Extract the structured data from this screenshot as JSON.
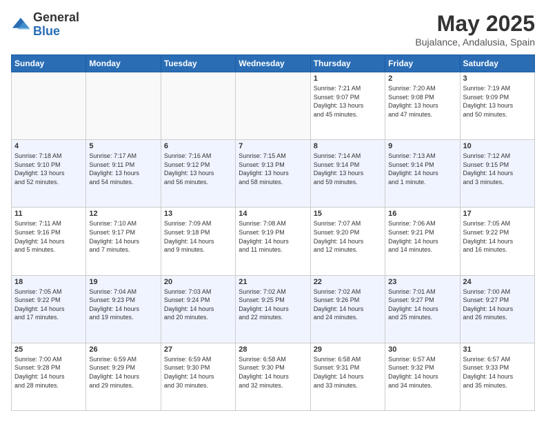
{
  "logo": {
    "general": "General",
    "blue": "Blue"
  },
  "header": {
    "month_title": "May 2025",
    "location": "Bujalance, Andalusia, Spain"
  },
  "weekdays": [
    "Sunday",
    "Monday",
    "Tuesday",
    "Wednesday",
    "Thursday",
    "Friday",
    "Saturday"
  ],
  "weeks": [
    [
      {
        "day": "",
        "info": ""
      },
      {
        "day": "",
        "info": ""
      },
      {
        "day": "",
        "info": ""
      },
      {
        "day": "",
        "info": ""
      },
      {
        "day": "1",
        "info": "Sunrise: 7:21 AM\nSunset: 9:07 PM\nDaylight: 13 hours\nand 45 minutes."
      },
      {
        "day": "2",
        "info": "Sunrise: 7:20 AM\nSunset: 9:08 PM\nDaylight: 13 hours\nand 47 minutes."
      },
      {
        "day": "3",
        "info": "Sunrise: 7:19 AM\nSunset: 9:09 PM\nDaylight: 13 hours\nand 50 minutes."
      }
    ],
    [
      {
        "day": "4",
        "info": "Sunrise: 7:18 AM\nSunset: 9:10 PM\nDaylight: 13 hours\nand 52 minutes."
      },
      {
        "day": "5",
        "info": "Sunrise: 7:17 AM\nSunset: 9:11 PM\nDaylight: 13 hours\nand 54 minutes."
      },
      {
        "day": "6",
        "info": "Sunrise: 7:16 AM\nSunset: 9:12 PM\nDaylight: 13 hours\nand 56 minutes."
      },
      {
        "day": "7",
        "info": "Sunrise: 7:15 AM\nSunset: 9:13 PM\nDaylight: 13 hours\nand 58 minutes."
      },
      {
        "day": "8",
        "info": "Sunrise: 7:14 AM\nSunset: 9:14 PM\nDaylight: 13 hours\nand 59 minutes."
      },
      {
        "day": "9",
        "info": "Sunrise: 7:13 AM\nSunset: 9:14 PM\nDaylight: 14 hours\nand 1 minute."
      },
      {
        "day": "10",
        "info": "Sunrise: 7:12 AM\nSunset: 9:15 PM\nDaylight: 14 hours\nand 3 minutes."
      }
    ],
    [
      {
        "day": "11",
        "info": "Sunrise: 7:11 AM\nSunset: 9:16 PM\nDaylight: 14 hours\nand 5 minutes."
      },
      {
        "day": "12",
        "info": "Sunrise: 7:10 AM\nSunset: 9:17 PM\nDaylight: 14 hours\nand 7 minutes."
      },
      {
        "day": "13",
        "info": "Sunrise: 7:09 AM\nSunset: 9:18 PM\nDaylight: 14 hours\nand 9 minutes."
      },
      {
        "day": "14",
        "info": "Sunrise: 7:08 AM\nSunset: 9:19 PM\nDaylight: 14 hours\nand 11 minutes."
      },
      {
        "day": "15",
        "info": "Sunrise: 7:07 AM\nSunset: 9:20 PM\nDaylight: 14 hours\nand 12 minutes."
      },
      {
        "day": "16",
        "info": "Sunrise: 7:06 AM\nSunset: 9:21 PM\nDaylight: 14 hours\nand 14 minutes."
      },
      {
        "day": "17",
        "info": "Sunrise: 7:05 AM\nSunset: 9:22 PM\nDaylight: 14 hours\nand 16 minutes."
      }
    ],
    [
      {
        "day": "18",
        "info": "Sunrise: 7:05 AM\nSunset: 9:22 PM\nDaylight: 14 hours\nand 17 minutes."
      },
      {
        "day": "19",
        "info": "Sunrise: 7:04 AM\nSunset: 9:23 PM\nDaylight: 14 hours\nand 19 minutes."
      },
      {
        "day": "20",
        "info": "Sunrise: 7:03 AM\nSunset: 9:24 PM\nDaylight: 14 hours\nand 20 minutes."
      },
      {
        "day": "21",
        "info": "Sunrise: 7:02 AM\nSunset: 9:25 PM\nDaylight: 14 hours\nand 22 minutes."
      },
      {
        "day": "22",
        "info": "Sunrise: 7:02 AM\nSunset: 9:26 PM\nDaylight: 14 hours\nand 24 minutes."
      },
      {
        "day": "23",
        "info": "Sunrise: 7:01 AM\nSunset: 9:27 PM\nDaylight: 14 hours\nand 25 minutes."
      },
      {
        "day": "24",
        "info": "Sunrise: 7:00 AM\nSunset: 9:27 PM\nDaylight: 14 hours\nand 26 minutes."
      }
    ],
    [
      {
        "day": "25",
        "info": "Sunrise: 7:00 AM\nSunset: 9:28 PM\nDaylight: 14 hours\nand 28 minutes."
      },
      {
        "day": "26",
        "info": "Sunrise: 6:59 AM\nSunset: 9:29 PM\nDaylight: 14 hours\nand 29 minutes."
      },
      {
        "day": "27",
        "info": "Sunrise: 6:59 AM\nSunset: 9:30 PM\nDaylight: 14 hours\nand 30 minutes."
      },
      {
        "day": "28",
        "info": "Sunrise: 6:58 AM\nSunset: 9:30 PM\nDaylight: 14 hours\nand 32 minutes."
      },
      {
        "day": "29",
        "info": "Sunrise: 6:58 AM\nSunset: 9:31 PM\nDaylight: 14 hours\nand 33 minutes."
      },
      {
        "day": "30",
        "info": "Sunrise: 6:57 AM\nSunset: 9:32 PM\nDaylight: 14 hours\nand 34 minutes."
      },
      {
        "day": "31",
        "info": "Sunrise: 6:57 AM\nSunset: 9:33 PM\nDaylight: 14 hours\nand 35 minutes."
      }
    ]
  ]
}
